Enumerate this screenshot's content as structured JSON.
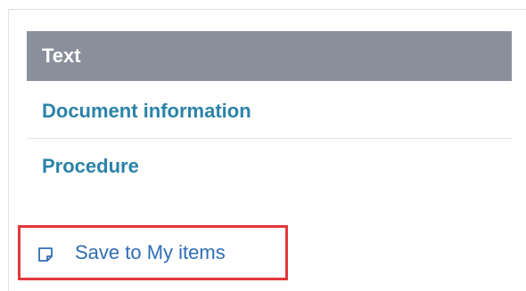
{
  "sidebar": {
    "header": "Text",
    "items": [
      {
        "label": "Document information"
      },
      {
        "label": "Procedure"
      }
    ]
  },
  "actions": {
    "save": {
      "label": "Save to My items",
      "icon": "note-icon"
    }
  },
  "colors": {
    "header_bg": "#8a909b",
    "link": "#2b83a8",
    "action_link": "#2f6db6",
    "highlight": "#e2373a"
  }
}
